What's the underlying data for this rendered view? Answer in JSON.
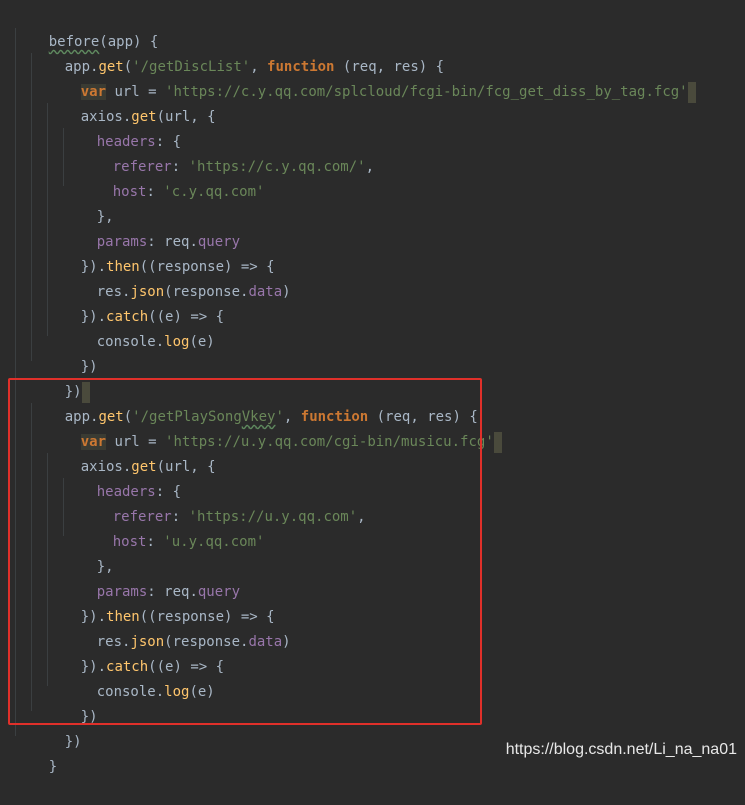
{
  "colors": {
    "background": "#2b2b2b",
    "keyword": "#cc7832",
    "function": "#ffc66d",
    "string": "#6a8759",
    "property": "#9876aa",
    "plain": "#a9b7c6",
    "highlight_box": "#e0302a"
  },
  "code": {
    "l1": {
      "t1": "before",
      "t2": "(app) {"
    },
    "l2": {
      "t1": "app.",
      "t2": "get",
      "t3": "(",
      "t4": "'/getDiscList'",
      "t5": ", ",
      "t6": "function",
      "t7": " (req, res) {"
    },
    "l3": {
      "t1": "var",
      "t2": " url = ",
      "t3": "'https://c.y.qq.com/splcloud/fcgi-bin/fcg_get_diss_by_tag.fcg'"
    },
    "l4": {
      "t1": "axios.",
      "t2": "get",
      "t3": "(url, {"
    },
    "l5": {
      "t1": "headers",
      "t2": ": {"
    },
    "l6": {
      "t1": "referer",
      "t2": ": ",
      "t3": "'https://c.y.qq.com/'",
      "t4": ","
    },
    "l7": {
      "t1": "host",
      "t2": ": ",
      "t3": "'c.y.qq.com'"
    },
    "l8": {
      "t1": "},"
    },
    "l9": {
      "t1": "params",
      "t2": ": req.",
      "t3": "query"
    },
    "l10": {
      "t1": "}).",
      "t2": "then",
      "t3": "((response) => {"
    },
    "l11": {
      "t1": "res.",
      "t2": "json",
      "t3": "(response.",
      "t4": "data",
      "t5": ")"
    },
    "l12": {
      "t1": "}).",
      "t2": "catch",
      "t3": "((e) => {"
    },
    "l13": {
      "t1": "console.",
      "t2": "log",
      "t3": "(e)"
    },
    "l14": {
      "t1": "})"
    },
    "l15": {
      "t1": "})"
    },
    "l16": {
      "t1": "app.",
      "t2": "get",
      "t3": "(",
      "t4": "'/getPlaySong",
      "t5": "Vkey",
      "t6": "'",
      "t7": ", ",
      "t8": "function",
      "t9": " (req, res) {"
    },
    "l17": {
      "t1": "var",
      "t2": " url = ",
      "t3": "'https://u.y.qq.com/cgi-bin/musicu.fcg'"
    },
    "l18": {
      "t1": "axios.",
      "t2": "get",
      "t3": "(url, {"
    },
    "l19": {
      "t1": "headers",
      "t2": ": {"
    },
    "l20": {
      "t1": "referer",
      "t2": ": ",
      "t3": "'https://u.y.qq.com'",
      "t4": ","
    },
    "l21": {
      "t1": "host",
      "t2": ": ",
      "t3": "'u.y.qq.com'"
    },
    "l22": {
      "t1": "},"
    },
    "l23": {
      "t1": "params",
      "t2": ": req.",
      "t3": "query"
    },
    "l24": {
      "t1": "}).",
      "t2": "then",
      "t3": "((response) => {"
    },
    "l25": {
      "t1": "res.",
      "t2": "json",
      "t3": "(response.",
      "t4": "data",
      "t5": ")"
    },
    "l26": {
      "t1": "}).",
      "t2": "catch",
      "t3": "((e) => {"
    },
    "l27": {
      "t1": "console.",
      "t2": "log",
      "t3": "(e)"
    },
    "l28": {
      "t1": "})"
    },
    "l29": {
      "t1": "})"
    },
    "l30": {
      "t1": "}"
    }
  },
  "watermark": "https://blog.csdn.net/Li_na_na01"
}
